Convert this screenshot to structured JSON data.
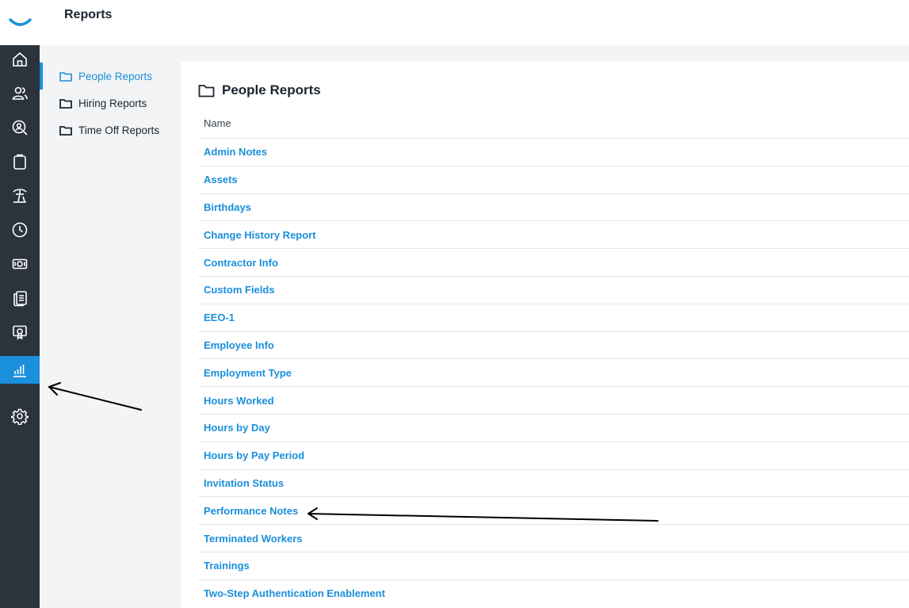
{
  "header": {
    "title": "Reports"
  },
  "colors": {
    "accent": "#1a8fdc",
    "rail": "#2b333c",
    "panel": "#f3f4f5"
  },
  "rail": {
    "items": [
      {
        "icon": "home-icon"
      },
      {
        "icon": "people-icon"
      },
      {
        "icon": "search-person-icon"
      },
      {
        "icon": "clipboard-icon"
      },
      {
        "icon": "palm-tree-icon"
      },
      {
        "icon": "clock-icon"
      },
      {
        "icon": "money-icon"
      },
      {
        "icon": "documents-icon"
      },
      {
        "icon": "certificate-icon"
      },
      {
        "icon": "bar-chart-icon",
        "active": true
      },
      {
        "icon": "gear-icon"
      }
    ]
  },
  "folders": [
    {
      "label": "People Reports",
      "active": true
    },
    {
      "label": "Hiring Reports",
      "active": false
    },
    {
      "label": "Time Off Reports",
      "active": false
    }
  ],
  "main": {
    "heading": "People Reports",
    "column_header": "Name",
    "reports": [
      "Admin Notes",
      "Assets",
      "Birthdays",
      "Change History Report",
      "Contractor Info",
      "Custom Fields",
      "EEO-1",
      "Employee Info",
      "Employment Type",
      "Hours Worked",
      "Hours by Day",
      "Hours by Pay Period",
      "Invitation Status",
      "Performance Notes",
      "Terminated Workers",
      "Trainings",
      "Two-Step Authentication Enablement"
    ]
  }
}
